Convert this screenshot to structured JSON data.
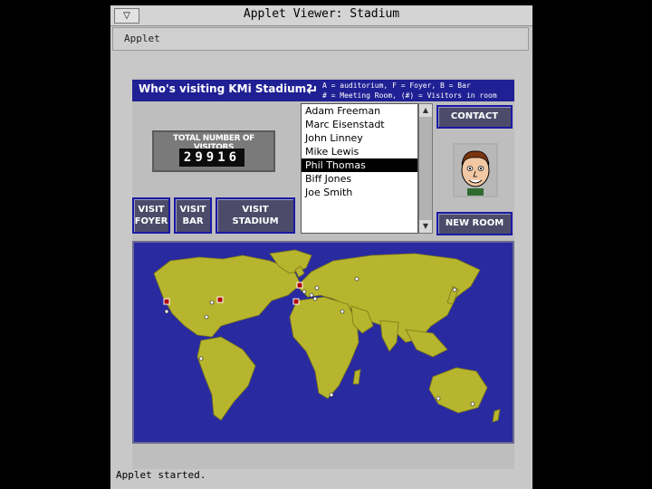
{
  "window": {
    "title": "Applet Viewer: Stadium",
    "menu_icon": "minimize-menu-icon"
  },
  "menubar": {
    "applet_menu": "Applet"
  },
  "header": {
    "title": "Who's visiting KMi Stadium?",
    "legend_line1": "A = auditorium, F = Foyer, B = Bar",
    "legend_line2": "# = Meeting Room, (#) = Visitors in room"
  },
  "counter": {
    "label": "TOTAL NUMBER OF VISITORS",
    "value": "29916"
  },
  "visitors": {
    "items": [
      "Adam Freeman",
      "Marc Eisenstadt",
      "John Linney",
      "Mike Lewis",
      "Phil Thomas",
      "Biff Jones",
      "Joe Smith"
    ],
    "selected": "Phil Thomas"
  },
  "buttons": {
    "contact": "CONTACT",
    "new_room": "NEW ROOM",
    "visit_foyer_1": "VISIT",
    "visit_foyer_2": "FOYER",
    "visit_bar_1": "VISIT",
    "visit_bar_2": "BAR",
    "visit_stadium_1": "VISIT",
    "visit_stadium_2": "STADIUM"
  },
  "map": {
    "ocean_color": "#2a2aa0",
    "land_color": "#b7b52e",
    "visitor_marker_color": "#ffffff",
    "room_marker_color": "#b00000"
  },
  "status": {
    "text": "Applet started."
  }
}
